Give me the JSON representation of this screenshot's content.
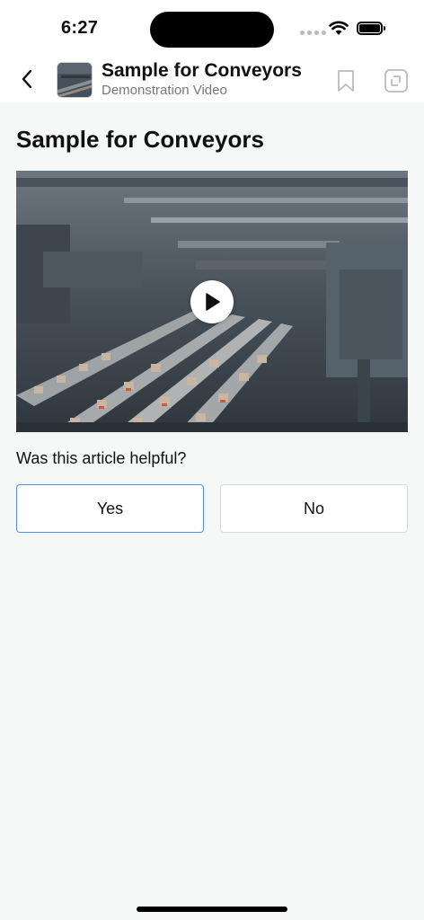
{
  "status_bar": {
    "time": "6:27",
    "icons": [
      "cellular-signal-icon",
      "wifi-icon",
      "battery-icon"
    ]
  },
  "header": {
    "title": "Sample for Conveyors",
    "subtitle": "Demonstration Video",
    "icons": [
      "back-chevron-icon",
      "video-thumbnail",
      "bookmark-icon",
      "copy-icon"
    ]
  },
  "article": {
    "title": "Sample for Conveyors",
    "video": {
      "icon": "play-icon"
    }
  },
  "feedback": {
    "question": "Was this article helpful?",
    "yes_label": "Yes",
    "no_label": "No",
    "selected_border_color": "#4f8ff2"
  },
  "colors": {
    "background": "#f6f7f7",
    "header_background": "#ffffff"
  }
}
